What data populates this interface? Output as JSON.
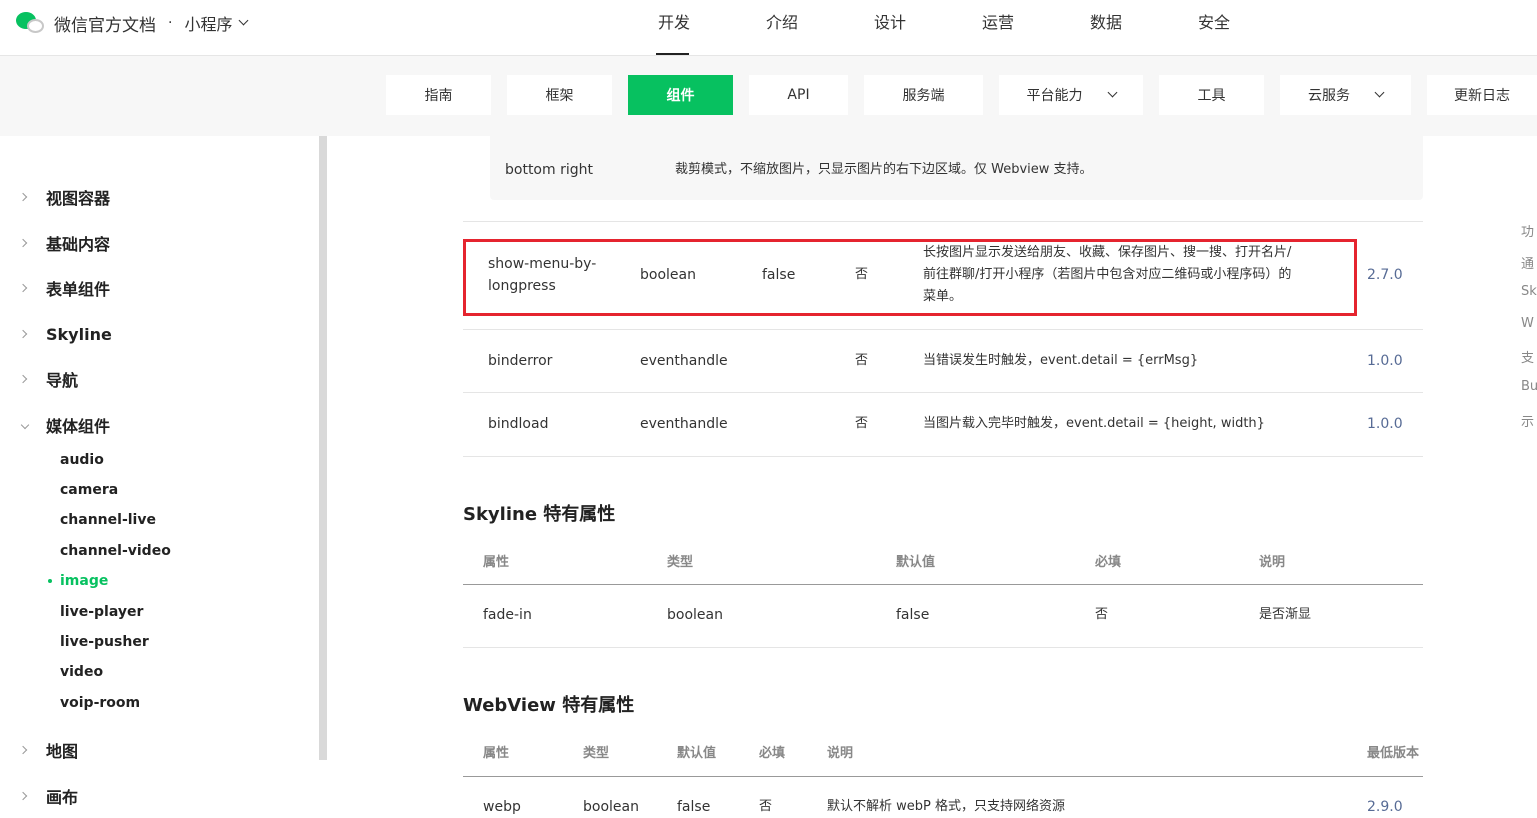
{
  "header": {
    "brand_title": "微信官方文档",
    "dot": "·",
    "product": "小程序",
    "nav": [
      "开发",
      "介绍",
      "设计",
      "运营",
      "数据",
      "安全"
    ],
    "active_nav": "开发"
  },
  "subtabs": [
    "指南",
    "框架",
    "组件",
    "API",
    "服务端",
    "平台能力",
    "工具",
    "云服务",
    "更新日志"
  ],
  "active_subtab": "组件",
  "sidebar": {
    "groups": [
      "视图容器",
      "基础内容",
      "表单组件",
      "Skyline",
      "导航",
      "媒体组件",
      "地图",
      "画布"
    ],
    "media_items": [
      "audio",
      "camera",
      "channel-live",
      "channel-video",
      "image",
      "live-player",
      "live-pusher",
      "video",
      "voip-room"
    ],
    "active_item": "image"
  },
  "main_table": {
    "top_row": {
      "name": "bottom right",
      "desc": "裁剪模式，不缩放图片，只显示图片的右下边区域。仅 Webview 支持。"
    },
    "rows": [
      {
        "name_line1": "show-menu-by-",
        "name_line2": "longpress",
        "type": "boolean",
        "default": "false",
        "required": "否",
        "desc_line1": "长按图片显示发送给朋友、收藏、保存图片、搜一搜、打开名片/",
        "desc_line2": "前往群聊/打开小程序（若图片中包含对应二维码或小程序码）的",
        "desc_line3": "菜单。",
        "version": "2.7.0"
      },
      {
        "name": "binderror",
        "type": "eventhandle",
        "required": "否",
        "desc": "当错误发生时触发，event.detail = {errMsg}",
        "version": "1.0.0"
      },
      {
        "name": "bindload",
        "type": "eventhandle",
        "required": "否",
        "desc": "当图片载入完毕时触发，event.detail = {height, width}",
        "version": "1.0.0"
      }
    ]
  },
  "skyline": {
    "title": "Skyline 特有属性",
    "headers": [
      "属性",
      "类型",
      "默认值",
      "必填",
      "说明"
    ],
    "row": [
      "fade-in",
      "boolean",
      "false",
      "否",
      "是否渐显"
    ]
  },
  "webview": {
    "title": "WebView 特有属性",
    "headers": [
      "属性",
      "类型",
      "默认值",
      "必填",
      "说明",
      "最低版本"
    ],
    "row": [
      "webp",
      "boolean",
      "false",
      "否",
      "默认不解析 webP 格式，只支持网络资源",
      "2.9.0"
    ]
  },
  "right_column": [
    "功",
    "通",
    "Sk",
    "W",
    "支",
    "Bu",
    "示"
  ],
  "colors": {
    "accent": "#07c160",
    "highlight_border": "#e5242f",
    "version_link": "#576b95"
  }
}
